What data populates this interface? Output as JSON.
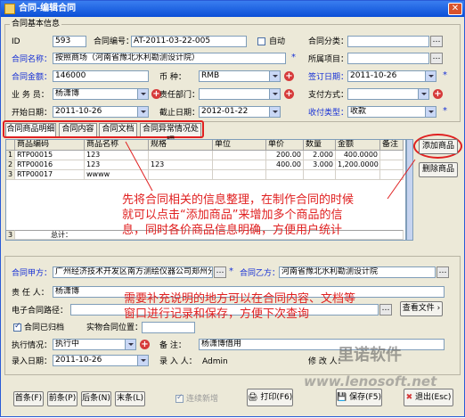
{
  "window": {
    "title": "合同-编辑合同"
  },
  "section": {
    "base_info": "合同基本信息"
  },
  "fields": {
    "id": {
      "label": "ID",
      "value": "593"
    },
    "contract_no": {
      "label": "合同编号：",
      "value": "AT-2011-03-22-005"
    },
    "auto": {
      "label": "自动"
    },
    "category": {
      "label": "合同分类：",
      "value": ""
    },
    "name": {
      "label": "合同名称：",
      "value": "按照商场（河南省豫北水利勘测设计院）"
    },
    "project": {
      "label": "所属项目：",
      "value": ""
    },
    "amount": {
      "label": "合同金额：",
      "value": "146000"
    },
    "currency": {
      "label": "币    种：",
      "value": "RMB"
    },
    "sign_date": {
      "label": "签订日期：",
      "value": "2011-10-26"
    },
    "salesman": {
      "label": "业 务 员：",
      "value": "杨潇博"
    },
    "dept": {
      "label": "责任部门：",
      "value": ""
    },
    "pay_method": {
      "label": "支付方式：",
      "value": ""
    },
    "start_date": {
      "label": "开始日期：",
      "value": "2011-10-26"
    },
    "end_date": {
      "label": "截止日期：",
      "value": "2012-01-22"
    },
    "receipt_type": {
      "label": "收付类型：",
      "value": "收款"
    }
  },
  "tabs": [
    "合同商品明细",
    "合同内容",
    "合同文档",
    "合同异常情况处理"
  ],
  "grid": {
    "columns": [
      "商品编码",
      "商品名称",
      "规格",
      "单位",
      "单价",
      "数量",
      "金额",
      "备注"
    ],
    "rows": [
      {
        "idx": "1",
        "code": "RTP00015",
        "name": "123",
        "spec": "",
        "unit": "",
        "price": "200.00",
        "qty": "2.000",
        "total": "400.0000",
        "note": ""
      },
      {
        "idx": "2",
        "code": "RTP00016",
        "name": "123",
        "spec": "123",
        "unit": "",
        "price": "400.00",
        "qty": "3.000",
        "total": "1,200.0000",
        "note": ""
      },
      {
        "idx": "3",
        "code": "RTP00017",
        "name": "wwww",
        "spec": "",
        "unit": "",
        "price": "",
        "qty": "",
        "total": "",
        "note": ""
      }
    ],
    "footer_idx": "3",
    "footer_label": "总计："
  },
  "side_buttons": {
    "add": "添加商品",
    "delete": "删除商品"
  },
  "annotations": {
    "a1": "先将合同相关的信息整理，在制作合同的时候",
    "a2": "就可以点击“添加商品”来增加多个商品的信",
    "a3": "息，同时各价商品信息明确，方便用户统计",
    "b1": "需要补充说明的地方可以在合同内容、文档等",
    "b2": "窗口进行记录和保存，方便下次查询"
  },
  "lower": {
    "party_a": {
      "label": "合同甲方：",
      "value": "广州经济技术开发区南方测绘仪器公司郑州分公"
    },
    "party_b": {
      "label": "合同乙方：",
      "value": "河南省豫北水利勘测设计院"
    },
    "responsible": {
      "label": "责 任 人：",
      "value": "杨潇博"
    },
    "e_path": {
      "label": "电子合同路径：",
      "value": ""
    },
    "view_file": "查看文件",
    "archived": {
      "label": "合同已归档"
    },
    "physical_pos": {
      "label": "实物合同位置：",
      "value": ""
    },
    "exec_status": {
      "label": "执行情况：",
      "value": "执行中"
    },
    "remark": {
      "label": "备    注：",
      "value": "杨潇博借用"
    },
    "entry_date": {
      "label": "录入日期：",
      "value": "2011-10-26"
    },
    "entry_person": {
      "label": "录 入 人：",
      "value": "Admin"
    },
    "modifier": {
      "label": "修 改 人：",
      "value": ""
    }
  },
  "bottom": {
    "first": "首条(F)",
    "prev": "前条(P)",
    "next": "后条(N)",
    "last": "末条(L)",
    "continuous": "连续新增",
    "print": "打印(F6)",
    "save": "保存(F5)",
    "exit": "退出(Esc)"
  },
  "watermark": {
    "cn": "里诺软件",
    "url": "www.lenosoft.net"
  }
}
